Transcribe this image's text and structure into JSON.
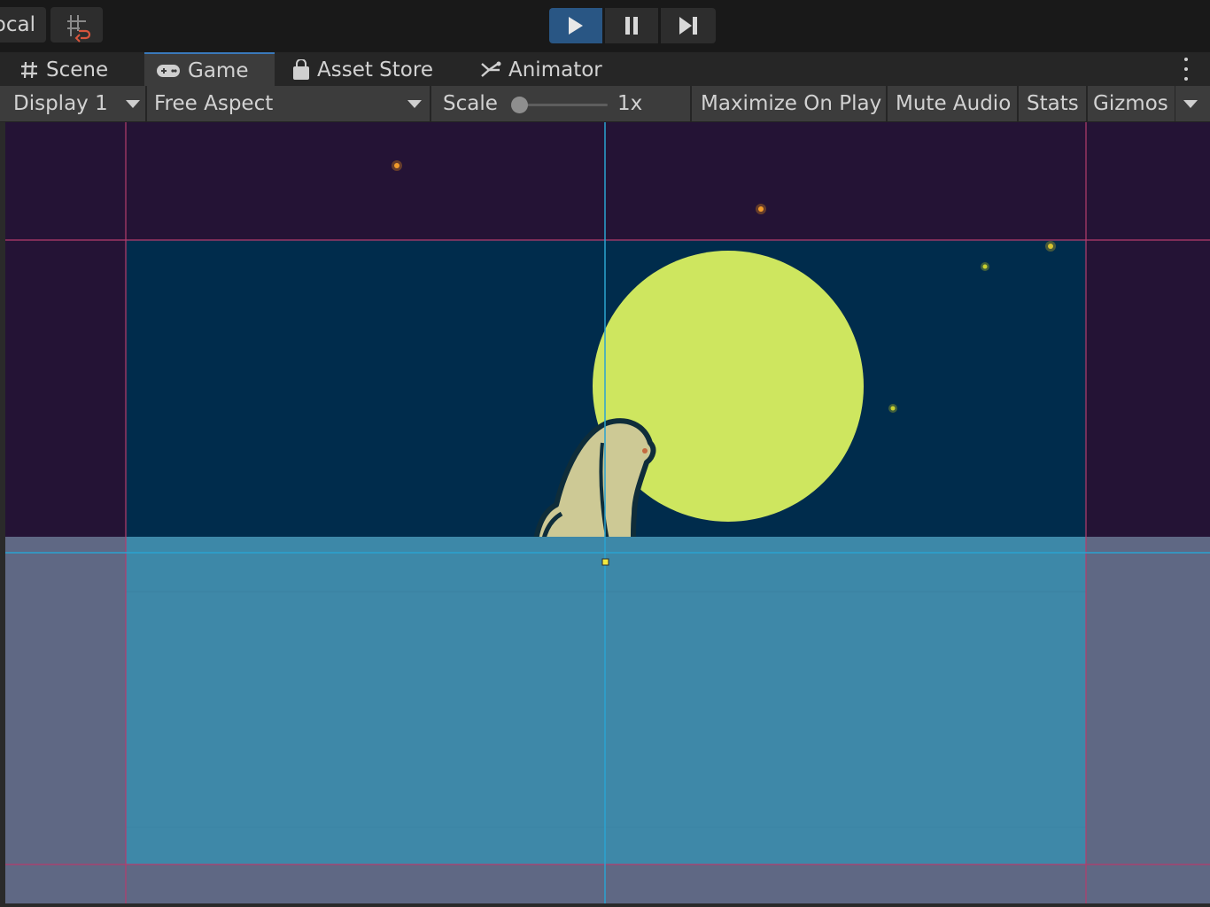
{
  "topbar": {
    "pivot_label": "ocal",
    "snap_icon": "grid-snap-icon",
    "play_icon": "play-icon",
    "pause_icon": "pause-icon",
    "step_icon": "step-forward-icon",
    "play_active": true
  },
  "tabs": [
    {
      "label": "Scene",
      "icon": "grid-hash-icon"
    },
    {
      "label": "Game",
      "icon": "gamepad-icon",
      "active": true
    },
    {
      "label": "Asset Store",
      "icon": "shopping-bag-icon"
    },
    {
      "label": "Animator",
      "icon": "animator-icon"
    }
  ],
  "toolbar": {
    "display": "Display 1",
    "aspect": "Free Aspect",
    "scale_label": "Scale",
    "scale_value": "1x",
    "scale_level": 0.0,
    "maximize": "Maximize On Play",
    "mute": "Mute Audio",
    "stats": "Stats",
    "gizmos": "Gizmos"
  },
  "colors": {
    "accent": "#3a79bb",
    "play_active_bg": "#295684",
    "sky_top": "#241335",
    "sky": "#002c4c",
    "moon": "#cee65f",
    "water": "#3e88a8",
    "water_outside": "#5f6884",
    "guide_line_pink": "#b43c6c",
    "guide_line_blue": "#2aa3d0",
    "creature_body": "#cdc995",
    "creature_outline": "#0f2d3a"
  }
}
